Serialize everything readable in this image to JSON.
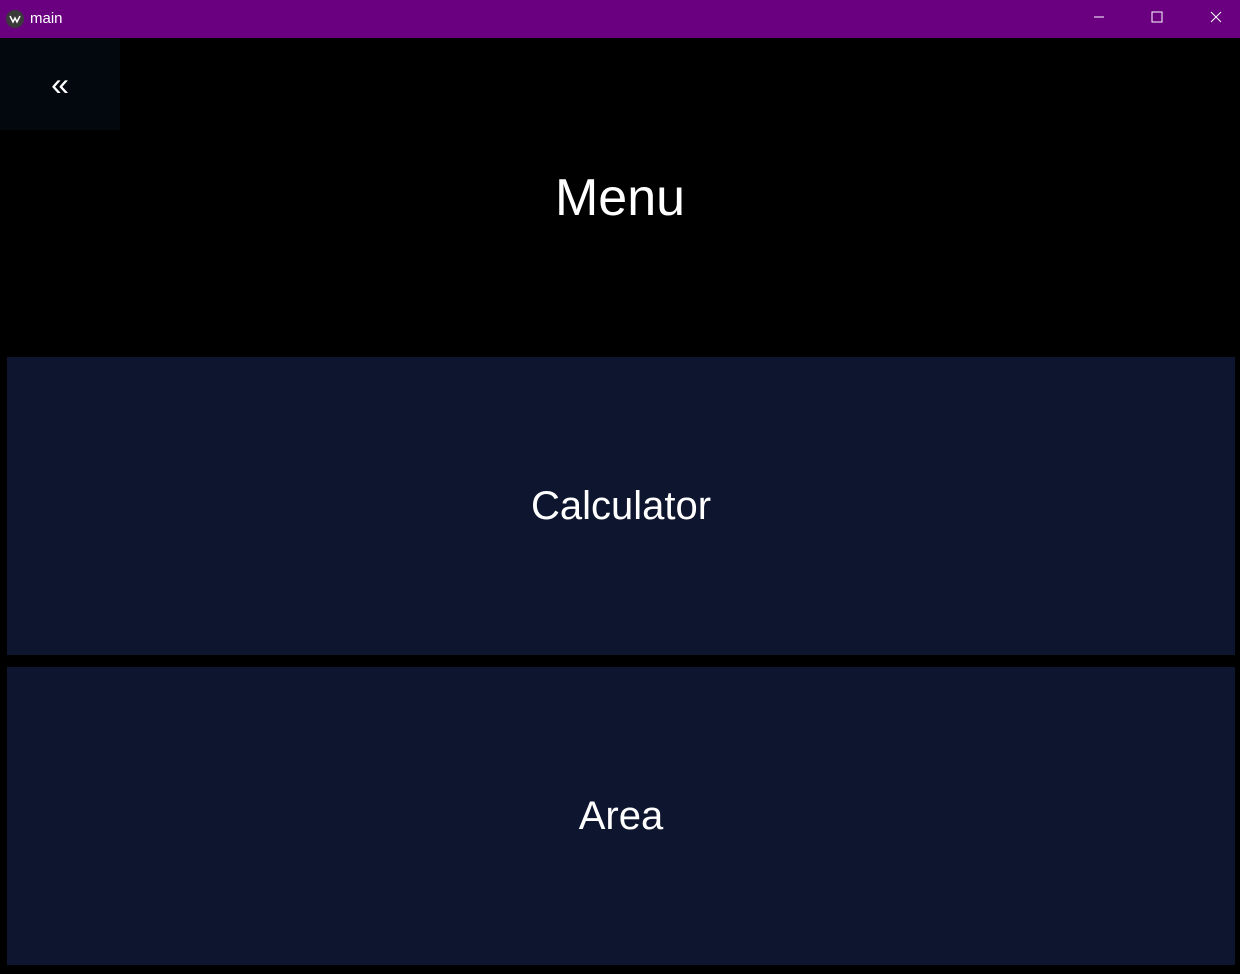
{
  "window": {
    "title": "main",
    "icon": "kivy-app-icon",
    "titlebar_color": "#6a0080",
    "controls": [
      "minimize-icon",
      "maximize-icon",
      "close-icon"
    ]
  },
  "nav": {
    "back_label": "«"
  },
  "page": {
    "title": "Menu"
  },
  "menu": {
    "items": [
      {
        "label": "Calculator"
      },
      {
        "label": "Area"
      }
    ],
    "button_color": "#0e152e"
  }
}
